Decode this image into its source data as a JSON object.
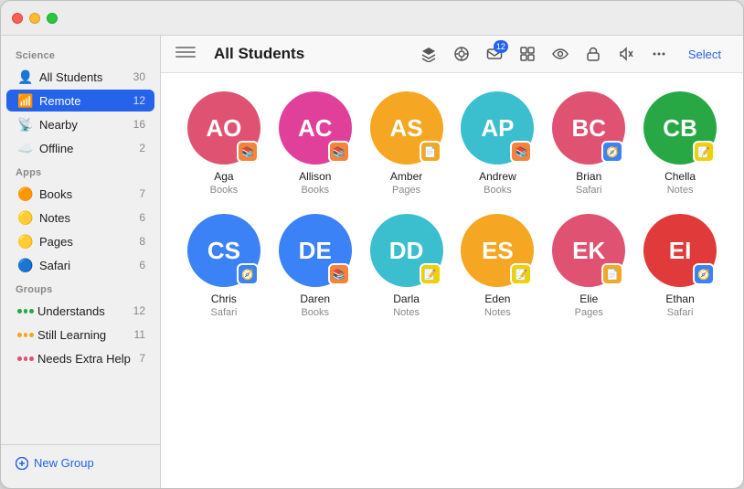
{
  "window": {
    "title": "All Students"
  },
  "sidebar": {
    "science_label": "Science",
    "all_students_label": "All Students",
    "all_students_count": "30",
    "remote_label": "Remote",
    "remote_count": "12",
    "nearby_label": "Nearby",
    "nearby_count": "16",
    "offline_label": "Offline",
    "offline_count": "2",
    "apps_label": "Apps",
    "books_label": "Books",
    "books_count": "7",
    "notes_label": "Notes",
    "notes_count": "6",
    "pages_label": "Pages",
    "pages_count": "8",
    "safari_label": "Safari",
    "safari_count": "6",
    "groups_label": "Groups",
    "understands_label": "Understands",
    "understands_count": "12",
    "still_learning_label": "Still Learning",
    "still_learning_count": "11",
    "needs_extra_label": "Needs Extra Help",
    "needs_extra_count": "7",
    "new_group_label": "New Group"
  },
  "toolbar": {
    "select_label": "Select",
    "mail_badge": "12"
  },
  "students": [
    {
      "initials": "AO",
      "name": "Aga",
      "app": "Books",
      "avatar_color": "#e05271",
      "badge": "books"
    },
    {
      "initials": "AC",
      "name": "Allison",
      "app": "Books",
      "avatar_color": "#e0409a",
      "badge": "books"
    },
    {
      "initials": "AS",
      "name": "Amber",
      "app": "Pages",
      "avatar_color": "#f5a623",
      "badge": "pages"
    },
    {
      "initials": "AP",
      "name": "Andrew",
      "app": "Books",
      "avatar_color": "#3bbfcf",
      "badge": "books"
    },
    {
      "initials": "BC",
      "name": "Brian",
      "app": "Safari",
      "avatar_color": "#e05271",
      "badge": "safari"
    },
    {
      "initials": "CB",
      "name": "Chella",
      "app": "Notes",
      "avatar_color": "#28a745",
      "badge": "notes"
    },
    {
      "initials": "CS",
      "name": "Chris",
      "app": "Safari",
      "avatar_color": "#3b82f6",
      "badge": "safari"
    },
    {
      "initials": "DE",
      "name": "Daren",
      "app": "Books",
      "avatar_color": "#3b82f6",
      "badge": "books"
    },
    {
      "initials": "DD",
      "name": "Darla",
      "app": "Notes",
      "avatar_color": "#3bbfcf",
      "badge": "notes"
    },
    {
      "initials": "ES",
      "name": "Eden",
      "app": "Notes",
      "avatar_color": "#f5a623",
      "badge": "notes"
    },
    {
      "initials": "EK",
      "name": "Elie",
      "app": "Pages",
      "avatar_color": "#e05271",
      "badge": "pages"
    },
    {
      "initials": "EI",
      "name": "Ethan",
      "app": "Safari",
      "avatar_color": "#e03a3a",
      "badge": "safari"
    }
  ]
}
